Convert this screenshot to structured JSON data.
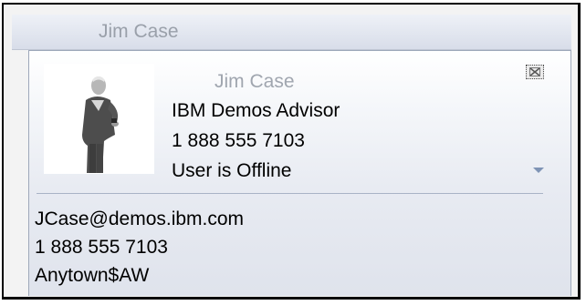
{
  "window": {
    "title": "Jim Case"
  },
  "card": {
    "name": "Jim Case",
    "job_title": "IBM Demos Advisor",
    "phone": "1 888 555 7103",
    "status": "User is Offline",
    "email": "JCase@demos.ibm.com",
    "phone_detail": "1 888 555 7103",
    "location": "Anytown$AW"
  },
  "icons": {
    "close": "close-icon",
    "dropdown": "chevron-down-icon",
    "photo": "person-photo"
  },
  "colors": {
    "titlebar_text": "#9aa0aa",
    "name_text": "#a0a6af",
    "accent": "#7f94b5",
    "border": "#000000"
  }
}
